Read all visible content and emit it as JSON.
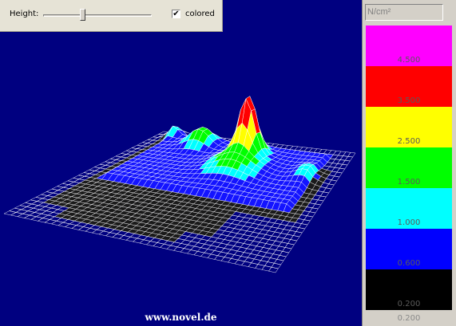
{
  "toolbar": {
    "height_label": "Height:",
    "height_slider_fraction": 0.37,
    "colored_checked": true,
    "colored_check_glyph": "✔",
    "colored_label": "colored"
  },
  "footer": {
    "url": "www.novel.de"
  },
  "legend": {
    "unit": "N/cm²",
    "bands": [
      {
        "label": "4.500",
        "color": "#ff00ff"
      },
      {
        "label": "3.500",
        "color": "#ff0000"
      },
      {
        "label": "2.500",
        "color": "#ffff00"
      },
      {
        "label": "1.500",
        "color": "#00ff00"
      },
      {
        "label": "1.000",
        "color": "#00ffff"
      },
      {
        "label": "0.600",
        "color": "#0000ff"
      },
      {
        "label": "0.200",
        "color": "#000000"
      }
    ],
    "bottom_label": "0.200"
  },
  "plot": {
    "background_color": "#000080",
    "mesh_line_color": "#ffffff",
    "surface_colors": {
      "lowest": "#1a1a1a",
      "low": "#1414ff",
      "mid": "#00ffff",
      "high": "#00ff00",
      "peak": "#ffff00",
      "top": "#ff0000"
    }
  }
}
